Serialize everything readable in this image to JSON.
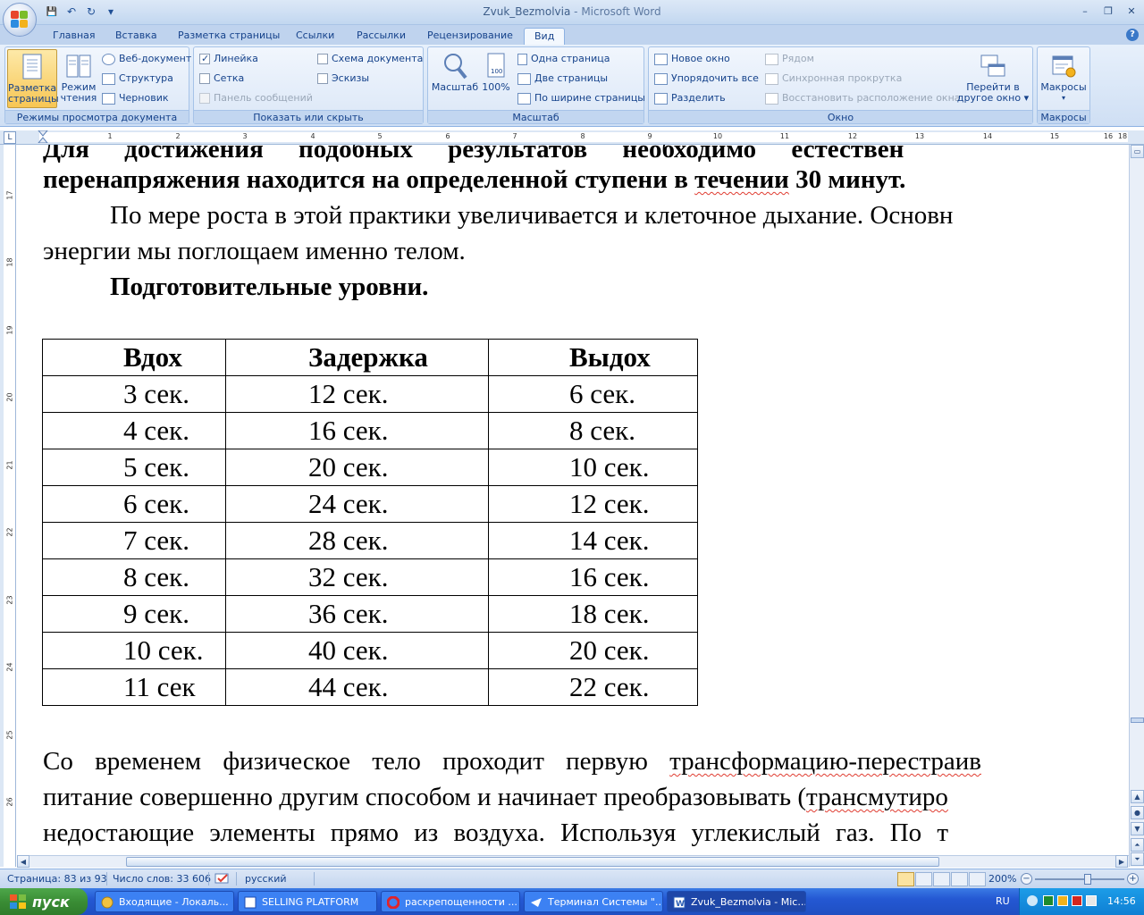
{
  "window": {
    "doc_name": "Zvuk_Bezmolvia",
    "separator": " - ",
    "app_name": "Microsoft Word",
    "minimize": "–",
    "restore": "❐",
    "close": "✕"
  },
  "qat": {
    "save": "💾",
    "undo": "↶",
    "redo": "↻",
    "customize": "▾"
  },
  "tabs": [
    "Главная",
    "Вставка",
    "Разметка страницы",
    "Ссылки",
    "Рассылки",
    "Рецензирование",
    "Вид"
  ],
  "help": "?",
  "ribbon": {
    "views": {
      "page_layout": [
        "Разметка",
        "страницы"
      ],
      "reading": [
        "Режим",
        "чтения"
      ],
      "web": "Веб-документ",
      "outline": "Структура",
      "draft": "Черновик",
      "label": "Режимы просмотра документа"
    },
    "show_hide": {
      "ruler": "Линейка",
      "gridlines": "Сетка",
      "message_bar": "Панель сообщений",
      "doc_map": "Схема документа",
      "thumbnails": "Эскизы",
      "label": "Показать или скрыть"
    },
    "zoom": {
      "zoom": "Масштаб",
      "hundred": "100%",
      "one_page": "Одна страница",
      "two_pages": "Две страницы",
      "page_width": "По ширине страницы",
      "label": "Масштаб"
    },
    "window_group": {
      "new_window": "Новое окно",
      "arrange_all": "Упорядочить все",
      "split": "Разделить",
      "side_by_side": "Рядом",
      "sync_scroll": "Синхронная прокрутка",
      "reset_pos": "Восстановить расположение окна",
      "switch": [
        "Перейти в",
        "другое окно ▾"
      ],
      "label": "Окно"
    },
    "macros": {
      "btn": "Макросы",
      "dropdown": "▾",
      "label": "Макросы"
    }
  },
  "ruler": {
    "corner": "L",
    "numbers": [
      "1",
      "2",
      "3",
      "4",
      "5",
      "6",
      "7",
      "8",
      "9",
      "10",
      "11",
      "12",
      "13",
      "14",
      "15",
      "16"
    ],
    "end": "18",
    "vertical": [
      "17",
      "18",
      "19",
      "20",
      "21",
      "22",
      "23",
      "24",
      "25",
      "26"
    ]
  },
  "doc": {
    "line_top": "Для достижения подобных результатов необходимо естествен",
    "line1": "перенапряжения  находится на определенной ступени в течении 30 минут.",
    "line1_pre": "перенапряжения  находится на определенной ступени в ",
    "line1_squig": "течении",
    "line1_post": " 30 минут.",
    "para2_line1": "По мере роста в этой практики увеличивается и клеточное дыхание. Основн",
    "para2_line2": "энергии мы поглощаем именно телом.",
    "heading": "Подготовительные уровни.",
    "table": {
      "headers": [
        "Вдох",
        "Задержка",
        "Выдох"
      ],
      "rows": [
        [
          "3 сек.",
          "12 сек.",
          "6 сек."
        ],
        [
          "4 сек.",
          "16 сек.",
          "8 сек."
        ],
        [
          "5 сек.",
          "20 сек.",
          "10 сек."
        ],
        [
          "6 сек.",
          "24 сек.",
          "12 сек."
        ],
        [
          "7 сек.",
          "28 сек.",
          "14 сек."
        ],
        [
          "8 сек.",
          "32 сек.",
          "16 сек."
        ],
        [
          "9 сек.",
          "36 сек.",
          "18 сек."
        ],
        [
          "10 сек.",
          "40 сек.",
          "20 сек."
        ],
        [
          "11 сек",
          "44 сек.",
          "22 сек."
        ]
      ]
    },
    "para3_line1_pre": "Со  временем  физическое  тело  проходит  первую  ",
    "para3_line1_squig": "трансформацию-перестраив",
    "para3_line2_pre": "питание совершенно другим способом и начинает преобразовывать (",
    "para3_line2_squig": "трансмутиро",
    "para3_line3": "недостающие  элементы  прямо  из  воздуха.  Используя  углекислый  газ. По  т"
  },
  "status": {
    "page": "Страница: 83 из 93",
    "words": "Число слов: 33 606",
    "language": "русский",
    "zoom": "200%",
    "zoom_minus": "−",
    "zoom_plus": "+"
  },
  "taskbar": {
    "start": "пуск",
    "tasks": [
      "Входящие - Локаль...",
      "SELLING PLATFORM",
      "раскрепощенности ...",
      "Терминал Системы \"...",
      "Zvuk_Bezmolvia - Mic..."
    ],
    "lang": "RU",
    "time": "14:56"
  },
  "colors": {
    "accent": "#15428b",
    "task_active": "#1e46a8",
    "squiggle": "#e03c31"
  }
}
